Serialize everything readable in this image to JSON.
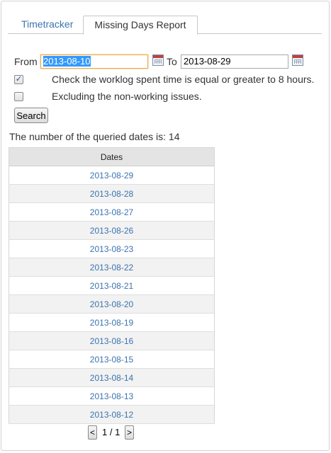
{
  "tabs": [
    {
      "label": "Timetracker",
      "active": false
    },
    {
      "label": "Missing Days Report",
      "active": true
    }
  ],
  "filters": {
    "from_label": "From",
    "from_value": "2013-08-10",
    "to_label": "To",
    "to_value": "2013-08-29",
    "check_worklog": {
      "label": "Check the worklog spent time is equal or greater to 8 hours.",
      "checked": true
    },
    "exclude_nonworking": {
      "label": "Excluding the non-working issues.",
      "checked": false
    },
    "search_label": "Search"
  },
  "result_count_text": "The number of the queried dates is: 14",
  "table": {
    "header": "Dates",
    "rows": [
      "2013-08-29",
      "2013-08-28",
      "2013-08-27",
      "2013-08-26",
      "2013-08-23",
      "2013-08-22",
      "2013-08-21",
      "2013-08-20",
      "2013-08-19",
      "2013-08-16",
      "2013-08-15",
      "2013-08-14",
      "2013-08-13",
      "2013-08-12"
    ]
  },
  "pager": {
    "prev": "<",
    "text": "1 / 1",
    "next": ">"
  },
  "colors": {
    "link": "#3b73af",
    "header_bg": "#e4e4e4",
    "row_alt": "#f2f2f2",
    "focus": "#e9a84a",
    "selection": "#3399ff"
  },
  "icons": {
    "calendar": "calendar-icon"
  }
}
